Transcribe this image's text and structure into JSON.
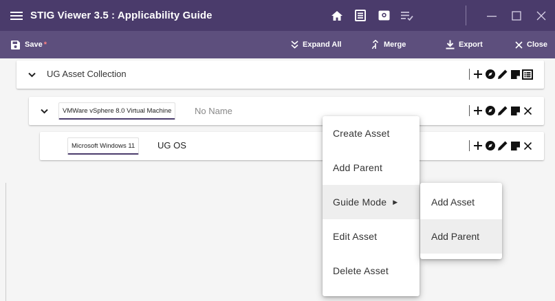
{
  "window": {
    "title": "STIG Viewer 3.5 : Applicability Guide",
    "title_icons": [
      "home-icon",
      "checklist-icon",
      "image-icon",
      "queue-icon"
    ],
    "controls": [
      "minimize-icon",
      "maximize-icon",
      "close-icon"
    ]
  },
  "toolbar": {
    "save_label": "Save",
    "save_indicator": "*",
    "expand_all_label": "Expand All",
    "merge_label": "Merge",
    "export_label": "Export",
    "close_label": "Close"
  },
  "tree": {
    "collection": {
      "label": "UG Asset Collection",
      "actions": [
        "add-icon",
        "compass-icon",
        "pencil-icon",
        "note-icon",
        "list-icon"
      ]
    },
    "assets": [
      {
        "chip": "VMWare vSphere 8.0 Virtual Machine",
        "name": "No Name",
        "name_is_placeholder": true,
        "actions": [
          "add-icon",
          "compass-icon",
          "pencil-icon",
          "note-icon",
          "delete-icon"
        ]
      },
      {
        "chip": "Microsoft Windows 11",
        "name": "UG OS",
        "name_is_placeholder": false,
        "actions": [
          "add-icon",
          "compass-icon",
          "pencil-icon",
          "note-icon",
          "delete-icon"
        ]
      }
    ]
  },
  "context_menu": {
    "items": [
      "Create Asset",
      "Add Parent",
      "Guide Mode",
      "Edit Asset",
      "Delete Asset"
    ],
    "active_item": "Guide Mode",
    "submenu": {
      "items": [
        "Add Asset",
        "Add Parent"
      ],
      "active_item": "Add Parent"
    }
  },
  "colors": {
    "titlebar": "#4a3b6b",
    "toolbar": "#5d4f7d",
    "background": "#f5f5f5",
    "save_indicator": "#ff8080",
    "placeholder_text": "#888888"
  }
}
